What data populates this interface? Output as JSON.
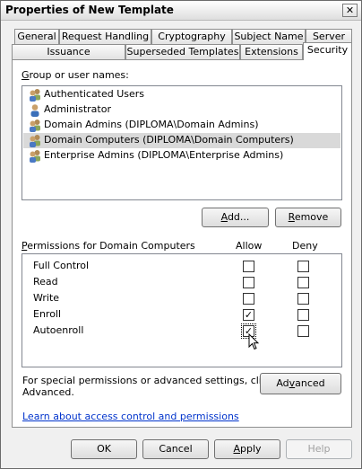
{
  "window": {
    "title": "Properties of New Template",
    "close_glyph": "✕"
  },
  "tabs_back": [
    "General",
    "Request Handling",
    "Cryptography",
    "Subject Name",
    "Server"
  ],
  "tabs_front": [
    "Issuance Requirements",
    "Superseded Templates",
    "Extensions",
    "Security"
  ],
  "active_tab": "Security",
  "group_label_a": "G",
  "group_label_b": "roup or user names:",
  "users": [
    {
      "name": "Authenticated Users",
      "icon": "group-users-icon",
      "selected": false
    },
    {
      "name": "Administrator",
      "icon": "user-icon",
      "selected": false
    },
    {
      "name": "Domain Admins (DIPLOMA\\Domain Admins)",
      "icon": "group-users-icon",
      "selected": false
    },
    {
      "name": "Domain Computers (DIPLOMA\\Domain Computers)",
      "icon": "group-users-icon",
      "selected": true
    },
    {
      "name": "Enterprise Admins (DIPLOMA\\Enterprise Admins)",
      "icon": "group-users-icon",
      "selected": false
    }
  ],
  "buttons": {
    "add_a": "A",
    "add_b": "dd...",
    "remove_a": "R",
    "remove_b": "emove",
    "advanced_a": "Ad",
    "advanced_b": "v",
    "advanced_c": "anced",
    "ok": "OK",
    "cancel": "Cancel",
    "apply_a": "A",
    "apply_b": "pply",
    "help": "Help"
  },
  "permissions": {
    "label_a": "P",
    "label_b": "ermissions for Domain Computers",
    "allow_header": "Allow",
    "deny_header": "Deny",
    "rows": [
      {
        "name": "Full Control",
        "allow": false,
        "deny": false
      },
      {
        "name": "Read",
        "allow": false,
        "deny": false
      },
      {
        "name": "Write",
        "allow": false,
        "deny": false
      },
      {
        "name": "Enroll",
        "allow": true,
        "deny": false
      },
      {
        "name": "Autoenroll",
        "allow": true,
        "deny": false
      }
    ],
    "check_glyph": "✓"
  },
  "advanced_text_1": "For special permissions or advanced settings, click",
  "advanced_text_2": "Advanced.",
  "help_link": "Learn about access control and permissions"
}
